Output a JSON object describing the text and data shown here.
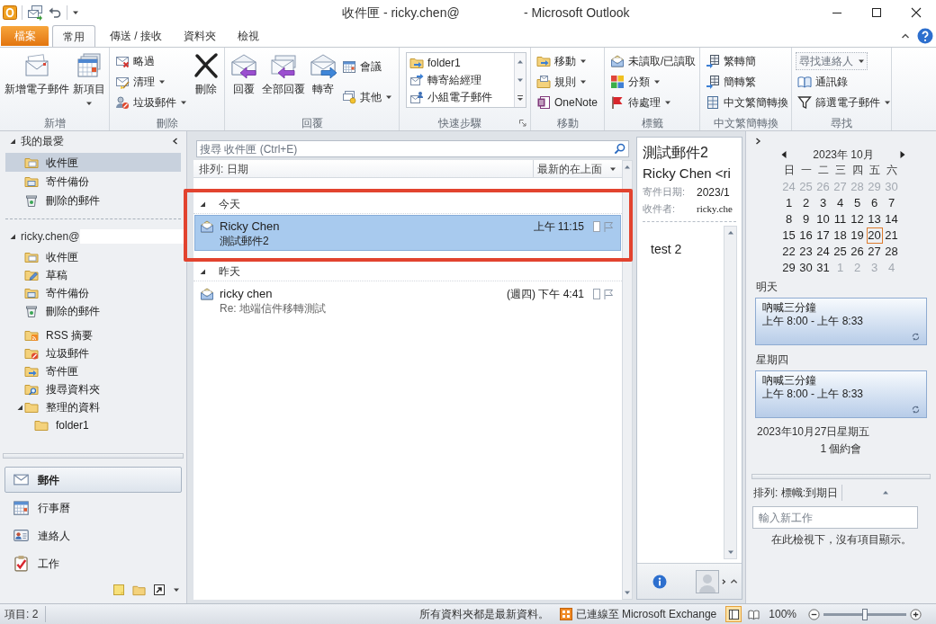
{
  "window": {
    "title": "收件匣 - ricky.chen@",
    "app_title": "- Microsoft Outlook"
  },
  "ribbon": {
    "tabs": [
      {
        "label": "檔案",
        "kind": "backstage",
        "selected": false
      },
      {
        "label": "常用",
        "kind": "tab",
        "selected": true
      },
      {
        "label": "傳送 / 接收",
        "kind": "tab",
        "selected": false
      },
      {
        "label": "資料夾",
        "kind": "tab",
        "selected": false
      },
      {
        "label": "檢視",
        "kind": "tab",
        "selected": false
      }
    ],
    "groups": [
      {
        "label": "新增",
        "launcher": false,
        "items": [
          {
            "label": "新增電子郵件",
            "kind": "new-mail",
            "dropdown": false
          },
          {
            "label": "新項目",
            "kind": "new-items",
            "dropdown": true
          }
        ]
      },
      {
        "label": "刪除",
        "launcher": false,
        "items": [
          {
            "label": "略過",
            "kind": "ignore",
            "dropdown": false
          },
          {
            "label": "清理",
            "kind": "clean-up",
            "dropdown": true
          },
          {
            "label": "垃圾郵件",
            "kind": "junk",
            "dropdown": true
          },
          {
            "label": "刪除",
            "kind": "delete",
            "dropdown": false
          }
        ]
      },
      {
        "label": "回覆",
        "launcher": false,
        "items": [
          {
            "label": "回覆",
            "kind": "reply",
            "dropdown": false
          },
          {
            "label": "全部回覆",
            "kind": "reply-all",
            "dropdown": false
          },
          {
            "label": "轉寄",
            "kind": "forward",
            "dropdown": false
          },
          {
            "label": "會議",
            "kind": "meeting",
            "dropdown": false
          },
          {
            "label": "其他",
            "kind": "more",
            "dropdown": true
          }
        ]
      },
      {
        "label": "快速步驟",
        "launcher": true,
        "items": [
          {
            "label": "folder1",
            "kind": "move-to"
          },
          {
            "label": "轉寄給經理",
            "kind": "to-manager"
          },
          {
            "label": "小組電子郵件",
            "kind": "team-email"
          }
        ]
      },
      {
        "label": "移動",
        "launcher": false,
        "items": [
          {
            "label": "移動",
            "kind": "move",
            "dropdown": true
          },
          {
            "label": "規則",
            "kind": "rules",
            "dropdown": true
          },
          {
            "label": "OneNote",
            "kind": "onenote",
            "dropdown": false
          }
        ]
      },
      {
        "label": "標籤",
        "launcher": false,
        "items": [
          {
            "label": "未讀取/已讀取",
            "kind": "unread",
            "dropdown": false
          },
          {
            "label": "分類",
            "kind": "categorize",
            "dropdown": true
          },
          {
            "label": "待處理",
            "kind": "follow-up",
            "dropdown": true
          }
        ]
      },
      {
        "label": "中文繁簡轉換",
        "launcher": false,
        "items": [
          {
            "label": "繁轉簡",
            "kind": "to-simplified",
            "dropdown": false
          },
          {
            "label": "簡轉繁",
            "kind": "to-traditional",
            "dropdown": false
          },
          {
            "label": "中文繁簡轉換",
            "kind": "convert",
            "dropdown": false
          }
        ]
      },
      {
        "label": "尋找",
        "launcher": false,
        "items": [
          {
            "placeholder": "尋找連絡人",
            "kind": "find-contact",
            "dropdown": true
          },
          {
            "label": "通訊錄",
            "kind": "address-book",
            "dropdown": false
          },
          {
            "label": "篩選電子郵件",
            "kind": "filter",
            "dropdown": true
          }
        ]
      }
    ]
  },
  "navigation": {
    "favorites": {
      "label": "我的最愛",
      "expanded": true,
      "folders": [
        {
          "name": "收件匣",
          "kind": "inbox",
          "selected": true
        },
        {
          "name": "寄件備份",
          "kind": "sent",
          "selected": false
        },
        {
          "name": "刪除的郵件",
          "kind": "deleted",
          "selected": false
        }
      ]
    },
    "mailbox": {
      "label": "ricky.chen@",
      "expanded": true,
      "folders": [
        {
          "name": "收件匣",
          "kind": "inbox",
          "selected": false
        },
        {
          "name": "草稿",
          "kind": "drafts",
          "selected": false
        },
        {
          "name": "寄件備份",
          "kind": "sent",
          "selected": false
        },
        {
          "name": "刪除的郵件",
          "kind": "deleted",
          "selected": false
        }
      ],
      "other_folders": [
        {
          "name": "RSS 摘要",
          "kind": "rss",
          "selected": false
        },
        {
          "name": "垃圾郵件",
          "kind": "junk",
          "selected": false
        },
        {
          "name": "寄件匣",
          "kind": "outbox",
          "selected": false
        },
        {
          "name": "搜尋資料夾",
          "kind": "search",
          "selected": false
        },
        {
          "name": "整理的資料",
          "kind": "folder",
          "selected": false,
          "expanded": true,
          "children": [
            {
              "name": "folder1",
              "kind": "folder",
              "selected": false
            }
          ]
        }
      ]
    },
    "sections": [
      {
        "label": "郵件",
        "kind": "mail",
        "selected": true
      },
      {
        "label": "行事曆",
        "kind": "calendar",
        "selected": false
      },
      {
        "label": "連絡人",
        "kind": "contacts",
        "selected": false
      },
      {
        "label": "工作",
        "kind": "tasks",
        "selected": false
      }
    ]
  },
  "message_list": {
    "search": {
      "placeholder": "搜尋 收件匣 (Ctrl+E)"
    },
    "sort": {
      "label": "排列: 日期",
      "order": "最新的在上面"
    },
    "groups": [
      {
        "label": "今天",
        "expanded": true,
        "highlighted": true,
        "messages": [
          {
            "sender": "Ricky Chen",
            "time": "上午 11:15",
            "subject": "測試郵件2",
            "selected": true
          }
        ]
      },
      {
        "label": "昨天",
        "expanded": true,
        "highlighted": false,
        "messages": [
          {
            "sender": "ricky chen",
            "time": "(週四) 下午 4:41",
            "subject": "Re: 地端信件移轉測試",
            "selected": false
          }
        ]
      }
    ]
  },
  "reading_pane": {
    "subject": "測試郵件2",
    "from": "Ricky Chen <ri",
    "fields": [
      {
        "label": "寄件日期:",
        "value": "2023/1",
        "kind": "date"
      },
      {
        "label": "收件者:",
        "value": "ricky.che",
        "kind": "recipients"
      }
    ],
    "body": "test 2"
  },
  "todo_bar": {
    "calendar": {
      "month": "2023年 10月",
      "weekdays": [
        "日",
        "一",
        "二",
        "三",
        "四",
        "五",
        "六"
      ],
      "weeks": [
        [
          {
            "day": "24",
            "muted": true,
            "today": false
          },
          {
            "day": "25",
            "muted": true,
            "today": false
          },
          {
            "day": "26",
            "muted": true,
            "today": false
          },
          {
            "day": "27",
            "muted": true,
            "today": false
          },
          {
            "day": "28",
            "muted": true,
            "today": false
          },
          {
            "day": "29",
            "muted": true,
            "today": false
          },
          {
            "day": "30",
            "muted": true,
            "today": false
          }
        ],
        [
          {
            "day": "1",
            "muted": false,
            "today": false
          },
          {
            "day": "2",
            "muted": false,
            "today": false
          },
          {
            "day": "3",
            "muted": false,
            "today": false
          },
          {
            "day": "4",
            "muted": false,
            "today": false
          },
          {
            "day": "5",
            "muted": false,
            "today": false
          },
          {
            "day": "6",
            "muted": false,
            "today": false
          },
          {
            "day": "7",
            "muted": false,
            "today": false
          }
        ],
        [
          {
            "day": "8",
            "muted": false,
            "today": false
          },
          {
            "day": "9",
            "muted": false,
            "today": false
          },
          {
            "day": "10",
            "muted": false,
            "today": false
          },
          {
            "day": "11",
            "muted": false,
            "today": false
          },
          {
            "day": "12",
            "muted": false,
            "today": false
          },
          {
            "day": "13",
            "muted": false,
            "today": false
          },
          {
            "day": "14",
            "muted": false,
            "today": false
          }
        ],
        [
          {
            "day": "15",
            "muted": false,
            "today": false
          },
          {
            "day": "16",
            "muted": false,
            "today": false
          },
          {
            "day": "17",
            "muted": false,
            "today": false
          },
          {
            "day": "18",
            "muted": false,
            "today": false
          },
          {
            "day": "19",
            "muted": false,
            "today": false
          },
          {
            "day": "20",
            "muted": false,
            "today": true
          },
          {
            "day": "21",
            "muted": false,
            "today": false
          }
        ],
        [
          {
            "day": "22",
            "muted": false,
            "today": false
          },
          {
            "day": "23",
            "muted": false,
            "today": false
          },
          {
            "day": "24",
            "muted": false,
            "today": false
          },
          {
            "day": "25",
            "muted": false,
            "today": false
          },
          {
            "day": "26",
            "muted": false,
            "today": false
          },
          {
            "day": "27",
            "muted": false,
            "today": false
          },
          {
            "day": "28",
            "muted": false,
            "today": false
          }
        ],
        [
          {
            "day": "29",
            "muted": false,
            "today": false
          },
          {
            "day": "30",
            "muted": false,
            "today": false
          },
          {
            "day": "31",
            "muted": false,
            "today": false
          },
          {
            "day": "1",
            "muted": true,
            "today": false
          },
          {
            "day": "2",
            "muted": true,
            "today": false
          },
          {
            "day": "3",
            "muted": true,
            "today": false
          },
          {
            "day": "4",
            "muted": true,
            "today": false
          }
        ]
      ]
    },
    "agenda": [
      {
        "heading": "明天",
        "appointments": [
          {
            "title": "吶喊三分鐘",
            "time": "上午 8:00 - 上午 8:33",
            "recurring": true
          }
        ]
      },
      {
        "heading": "星期四",
        "appointments": [
          {
            "title": "吶喊三分鐘",
            "time": "上午 8:00 - 上午 8:33",
            "recurring": true
          }
        ]
      }
    ],
    "next_date": "2023年10月27日星期五",
    "next_count": "1 個約會",
    "tasks": {
      "sort": "排列: 標幟:到期日",
      "placeholder": "輸入新工作",
      "empty_message": "在此檢視下，沒有項目顯示。"
    }
  },
  "status_bar": {
    "item_count": "項目: 2",
    "sync": "所有資料夾都是最新資料。",
    "connection": "已連線至 Microsoft Exchange",
    "views": [
      {
        "kind": "normal",
        "selected": true
      },
      {
        "kind": "reading",
        "selected": false
      }
    ],
    "zoom": {
      "reading": "100%",
      "level": 0.5
    }
  }
}
